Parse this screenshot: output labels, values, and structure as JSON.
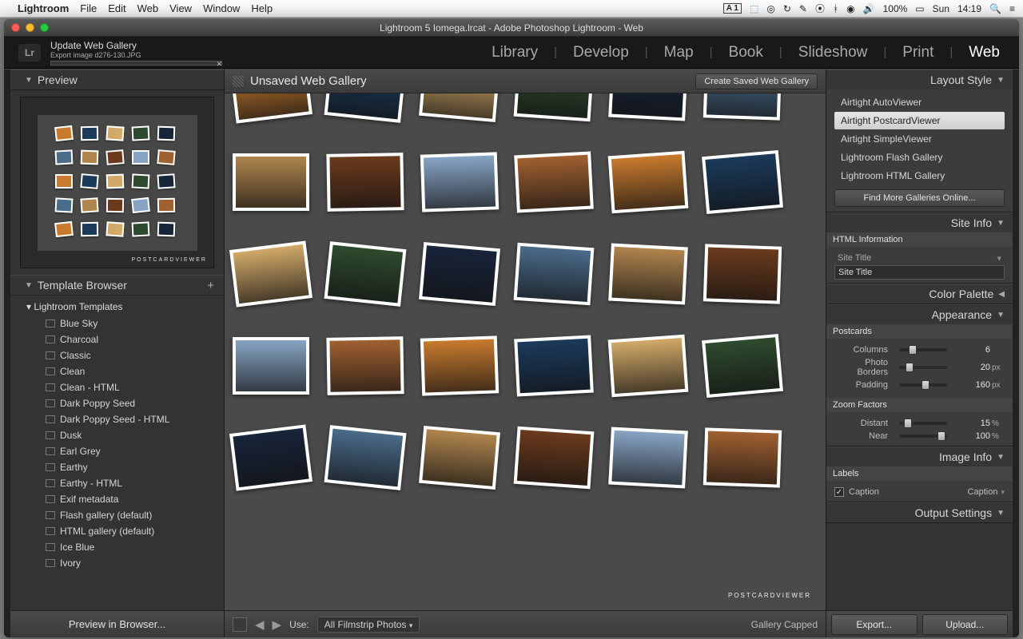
{
  "menubar": {
    "app": "Lightroom",
    "items": [
      "File",
      "Edit",
      "Web",
      "View",
      "Window",
      "Help"
    ],
    "tray": {
      "adobe": "1",
      "battery": "100%",
      "day": "Sun",
      "time": "14:19"
    }
  },
  "window_title": "Lightroom 5 Iomega.lrcat - Adobe Photoshop Lightroom - Web",
  "header": {
    "logo": "Lr",
    "task": "Update Web Gallery",
    "subtask": "Export image d276-130.JPG"
  },
  "modules": [
    "Library",
    "Develop",
    "Map",
    "Book",
    "Slideshow",
    "Print",
    "Web"
  ],
  "active_module": "Web",
  "left": {
    "preview_title": "Preview",
    "preview_mark": "POSTCARDVIEWER",
    "template_title": "Template Browser",
    "template_parent": "Lightroom Templates",
    "templates": [
      "Blue Sky",
      "Charcoal",
      "Classic",
      "Clean",
      "Clean - HTML",
      "Dark Poppy Seed",
      "Dark Poppy Seed - HTML",
      "Dusk",
      "Earl Grey",
      "Earthy",
      "Earthy - HTML",
      "Exif metadata",
      "Flash gallery (default)",
      "HTML gallery (default)",
      "Ice Blue",
      "Ivory"
    ],
    "preview_button": "Preview in Browser..."
  },
  "center": {
    "title": "Unsaved Web Gallery",
    "create_btn": "Create Saved Web Gallery",
    "use_label": "Use:",
    "use_value": "All Filmstrip Photos",
    "status": "Gallery Capped",
    "postmark": "POSTCARDVIEWER"
  },
  "right": {
    "layout_title": "Layout Style",
    "styles": [
      "Airtight AutoViewer",
      "Airtight PostcardViewer",
      "Airtight SimpleViewer",
      "Lightroom Flash Gallery",
      "Lightroom HTML Gallery"
    ],
    "selected_style": "Airtight PostcardViewer",
    "find_more": "Find More Galleries Online...",
    "siteinfo_title": "Site Info",
    "siteinfo_sub": "HTML Information",
    "site_title_lbl": "Site Title",
    "site_title_val": "Site Title",
    "palette_title": "Color Palette",
    "appearance_title": "Appearance",
    "postcards_sub": "Postcards",
    "columns_lbl": "Columns",
    "columns_val": "6",
    "borders_lbl": "Photo Borders",
    "borders_val": "20",
    "borders_unit": "px",
    "padding_lbl": "Padding",
    "padding_val": "160",
    "padding_unit": "px",
    "zoom_sub": "Zoom Factors",
    "distant_lbl": "Distant",
    "distant_val": "15",
    "distant_unit": "%",
    "near_lbl": "Near",
    "near_val": "100",
    "near_unit": "%",
    "imageinfo_title": "Image Info",
    "labels_sub": "Labels",
    "caption_lbl": "Caption",
    "caption_val": "Caption",
    "output_title": "Output Settings",
    "export_btn": "Export...",
    "upload_btn": "Upload..."
  }
}
